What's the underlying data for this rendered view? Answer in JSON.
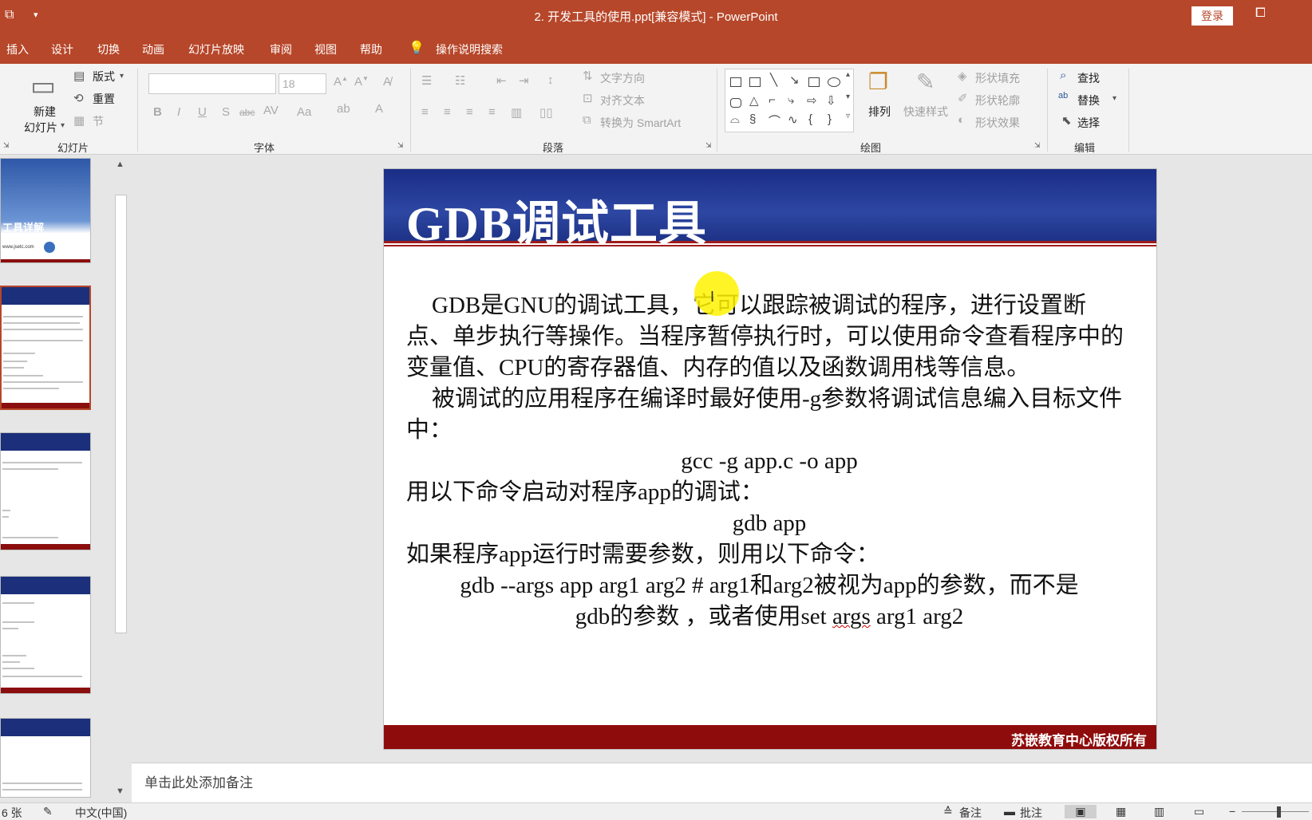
{
  "window": {
    "title": "2. 开发工具的使用.ppt[兼容模式]  -  PowerPoint",
    "login": "登录"
  },
  "menu": {
    "tabs": [
      "插入",
      "设计",
      "切换",
      "动画",
      "幻灯片放映",
      "审阅",
      "视图",
      "帮助"
    ],
    "search": "操作说明搜索"
  },
  "ribbon": {
    "slides_group": {
      "label": "幻灯片",
      "new_slide": "新建",
      "new_slide2": "幻灯片",
      "layout": "版式",
      "reset": "重置",
      "section": "节"
    },
    "font_group": {
      "label": "字体",
      "font_size": "18"
    },
    "paragraph_group": {
      "label": "段落",
      "text_direction": "文字方向",
      "align_text": "对齐文本",
      "smartart": "转换为 SmartArt"
    },
    "drawing_group": {
      "label": "绘图",
      "arrange": "排列",
      "quick_styles": "快速样式",
      "shape_fill": "形状填充",
      "shape_outline": "形状轮廓",
      "shape_effects": "形状效果"
    },
    "editing_group": {
      "label": "编辑",
      "find": "查找",
      "replace": "替换",
      "select": "选择"
    }
  },
  "thumbnails": {
    "slide1_text": "工具详解",
    "slide1_url": "www.jsetc.com"
  },
  "slide": {
    "title": "GDB调试工具",
    "para1": "GDB是GNU的调试工具，它可以跟踪被调试的程序，进行设置断点、单步执行等操作。当程序暂停执行时，可以使用命令查看程序中的变量值、CPU的寄存器值、内存的值以及函数调用栈等信息。",
    "para2": "被调试的应用程序在编译时最好使用-g参数将调试信息编入目标文件中：",
    "cmd1": "gcc -g app.c -o app",
    "para3": "用以下命令启动对程序app的调试：",
    "cmd2": "gdb app",
    "para4": "如果程序app运行时需要参数，则用以下命令：",
    "para5a": "gdb --args app arg1 arg2 # arg1和arg2被视为app的参数，而不是",
    "para5b_pre": "gdb的参数 ，或者使用set ",
    "para5b_err": "args",
    "para5b_post": " arg1 arg2",
    "footer": "苏嵌教育中心版权所有"
  },
  "notes": {
    "placeholder": "单击此处添加备注"
  },
  "status": {
    "slide_count": "6 张",
    "language": "中文(中国)",
    "notes_btn": "备注",
    "comments_btn": "批注"
  }
}
